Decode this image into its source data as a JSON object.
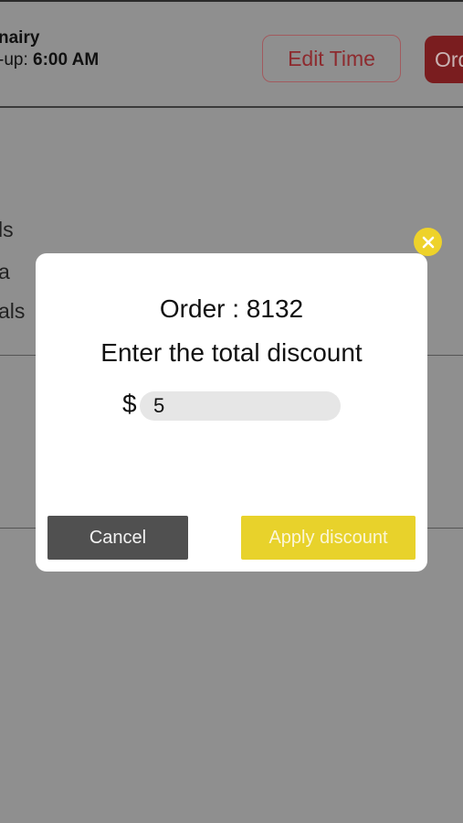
{
  "background": {
    "customer_name": "nairy",
    "pickup_prefix": "-up:",
    "pickup_time": "6:00 AM",
    "edit_time_label": "Edit Time",
    "order_button_label": "Ord",
    "side_labels": [
      "ls",
      "a",
      "als"
    ]
  },
  "dialog": {
    "close_icon": "close-icon",
    "order_label": "Order : 8132",
    "prompt": "Enter the total discount",
    "currency_symbol": "$",
    "discount_value": "5",
    "cancel_label": "Cancel",
    "apply_label": "Apply discount"
  },
  "colors": {
    "overlay": "#8f8f8f",
    "brand_red": "#7a1d1f",
    "accent_yellow": "#e8d22b",
    "cancel_gray": "#505050"
  }
}
